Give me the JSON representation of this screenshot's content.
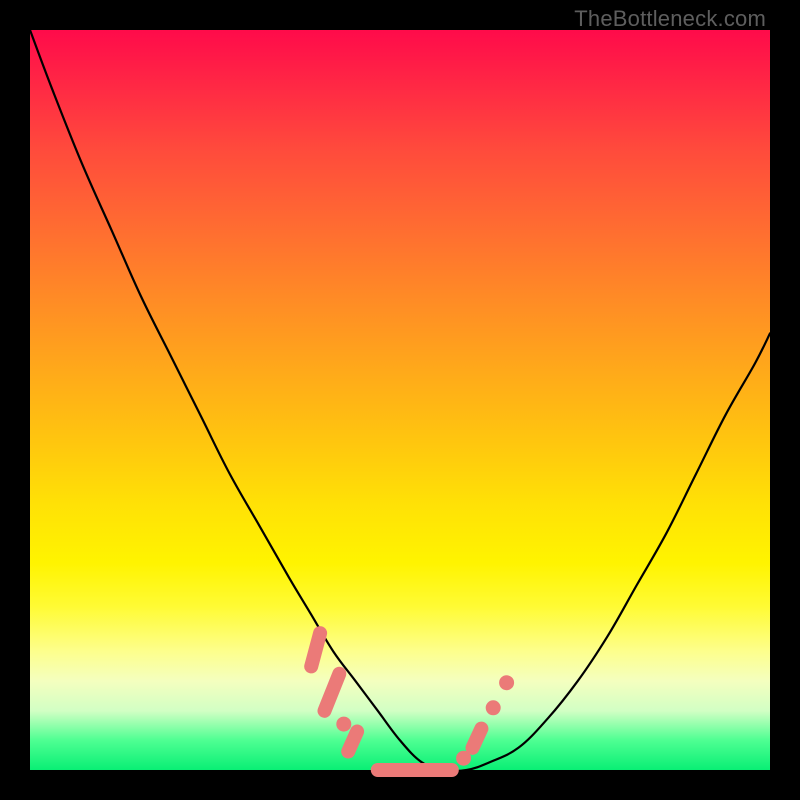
{
  "watermark": {
    "text": "TheBottleneck.com"
  },
  "colors": {
    "curve_stroke": "#000000",
    "marker_fill": "#eb7a78",
    "marker_stroke": "#eb7a78",
    "background_black": "#000000"
  },
  "chart_data": {
    "type": "line",
    "title": "",
    "xlabel": "",
    "ylabel": "",
    "xlim": [
      0,
      100
    ],
    "ylim": [
      0,
      100
    ],
    "grid": false,
    "legend": false,
    "series": [
      {
        "name": "bottleneck-curve",
        "x": [
          0,
          3,
          7,
          11,
          15,
          19,
          23,
          27,
          31,
          35,
          38,
          41,
          44,
          47,
          50,
          53,
          56,
          59,
          62,
          66,
          70,
          74,
          78,
          82,
          86,
          90,
          94,
          98,
          100
        ],
        "y": [
          100,
          92,
          82,
          73,
          64,
          56,
          48,
          40,
          33,
          26,
          21,
          16,
          12,
          8,
          4,
          1,
          0,
          0,
          1,
          3,
          7,
          12,
          18,
          25,
          32,
          40,
          48,
          55,
          59
        ]
      }
    ],
    "markers": [
      {
        "kind": "capsule",
        "x0": 38.0,
        "x1": 39.2,
        "y0": 14.0,
        "y1": 18.5
      },
      {
        "kind": "capsule",
        "x0": 39.8,
        "x1": 41.8,
        "y0": 8.0,
        "y1": 13.0
      },
      {
        "kind": "dot",
        "x": 42.4,
        "y": 6.2
      },
      {
        "kind": "capsule",
        "x0": 43.0,
        "x1": 44.2,
        "y0": 2.5,
        "y1": 5.2
      },
      {
        "kind": "capsule",
        "x0": 47.0,
        "x1": 57.0,
        "y0": 0.0,
        "y1": 0.0
      },
      {
        "kind": "dot",
        "x": 58.6,
        "y": 1.6
      },
      {
        "kind": "capsule",
        "x0": 59.8,
        "x1": 61.0,
        "y0": 3.0,
        "y1": 5.6
      },
      {
        "kind": "dot",
        "x": 62.6,
        "y": 8.4
      },
      {
        "kind": "dot",
        "x": 64.4,
        "y": 11.8
      }
    ]
  }
}
